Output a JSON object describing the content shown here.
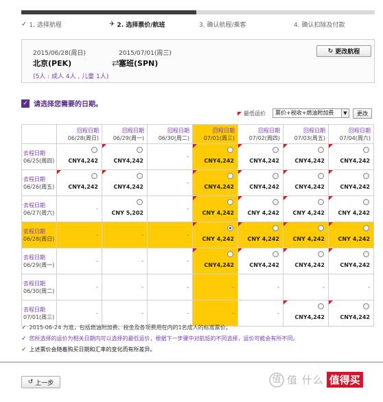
{
  "steps": [
    {
      "label": "1. 选择航程",
      "state": "done"
    },
    {
      "label": "2. 选择票价/航班",
      "state": "active"
    },
    {
      "label": "3. 确认航程/乘客",
      "state": "todo"
    },
    {
      "label": "4. 确认扣除及付款",
      "state": "todo"
    }
  ],
  "trip": {
    "depart_date": "2015/06/28(周日)",
    "return_date": "2015/07/01(周三)",
    "from": "北京(PEK)",
    "to": "塞班(SPN)",
    "arrow": "⇄",
    "pax": "(5人 : 成人 4人 , 儿童 1人)",
    "change_label": "更改航程"
  },
  "prompt": "请选择您需要的日期。",
  "legend_label": "最低运价",
  "fare_select": {
    "value": "票价+税收+燃油附加费"
  },
  "change_small": "更改",
  "grid": {
    "columns": [
      {
        "label": "回程日期",
        "date": "06/28(周日)"
      },
      {
        "label": "回程日期",
        "date": "06/29(周一)"
      },
      {
        "label": "回程日期",
        "date": "06/30(周二)"
      },
      {
        "label": "回程日期",
        "date": "07/01(周三)"
      },
      {
        "label": "回程日期",
        "date": "07/02(周四)"
      },
      {
        "label": "回程日期",
        "date": "07/03(周五)"
      },
      {
        "label": "回程日期",
        "date": "07/04(周六)"
      }
    ],
    "rows": [
      {
        "label": "去程日期",
        "date": "06/25(周四)",
        "cells": [
          {
            "v": "CNY4,242",
            "radio": true,
            "red": false,
            "hl": false
          },
          {
            "v": "CNY4,242",
            "radio": true,
            "red": true,
            "hl": false
          },
          {
            "v": "-",
            "radio": false,
            "red": false,
            "hl": false
          },
          {
            "v": "CNY4,242",
            "radio": true,
            "red": true,
            "hl": true
          },
          {
            "v": "CNY4,242",
            "radio": true,
            "red": true,
            "hl": false
          },
          {
            "v": "CNY4,242",
            "radio": true,
            "red": true,
            "hl": false
          },
          {
            "v": "CNY4,242",
            "radio": true,
            "red": true,
            "hl": false
          }
        ]
      },
      {
        "label": "去程日期",
        "date": "06/26(周五)",
        "cells": [
          {
            "v": "CNY4,242",
            "radio": true,
            "red": true,
            "hl": false
          },
          {
            "v": "CNY4,242",
            "radio": true,
            "red": true,
            "hl": false
          },
          {
            "v": "-",
            "radio": false,
            "red": false,
            "hl": false
          },
          {
            "v": "CNY4,242",
            "radio": true,
            "red": true,
            "hl": true
          },
          {
            "v": "CNY4,242",
            "radio": true,
            "red": true,
            "hl": false
          },
          {
            "v": "CNY4,242",
            "radio": true,
            "red": true,
            "hl": false
          },
          {
            "v": "CNY4,242",
            "radio": true,
            "red": true,
            "hl": false
          }
        ]
      },
      {
        "label": "去程日期",
        "date": "06/27(周六)",
        "cells": [
          {
            "v": "-",
            "radio": false,
            "red": false,
            "hl": false
          },
          {
            "v": "CNY 5,202",
            "radio": true,
            "red": false,
            "hl": false
          },
          {
            "v": "-",
            "radio": false,
            "red": false,
            "hl": false
          },
          {
            "v": "CNY 4,242",
            "radio": true,
            "red": true,
            "hl": true
          },
          {
            "v": "CNY 4,242",
            "radio": true,
            "red": true,
            "hl": false
          },
          {
            "v": "CNY 4,242",
            "radio": true,
            "red": true,
            "hl": false
          },
          {
            "v": "CNY 4,242",
            "radio": true,
            "red": true,
            "hl": false
          }
        ]
      },
      {
        "label": "去程日期",
        "date": "06/28(周日)",
        "row_hl": true,
        "cells": [
          {
            "v": "-",
            "radio": false,
            "red": false,
            "hl": true
          },
          {
            "v": "-",
            "radio": false,
            "red": false,
            "hl": true
          },
          {
            "v": "-",
            "radio": false,
            "red": false,
            "hl": true
          },
          {
            "v": "CNY 4,242",
            "radio": true,
            "on": true,
            "red": true,
            "hl": true
          },
          {
            "v": "CNY 4,242",
            "radio": true,
            "red": true,
            "hl": true
          },
          {
            "v": "CNY 4,242",
            "radio": true,
            "red": true,
            "hl": true
          },
          {
            "v": "CNY 4,242",
            "radio": true,
            "red": true,
            "hl": true
          }
        ]
      },
      {
        "label": "去程日期",
        "date": "06/29(周一)",
        "cells": [
          {
            "v": "-",
            "radio": false,
            "red": false,
            "hl": false
          },
          {
            "v": "-",
            "radio": false,
            "red": false,
            "hl": false
          },
          {
            "v": "-",
            "radio": false,
            "red": false,
            "hl": false
          },
          {
            "v": "CNY4,242",
            "radio": true,
            "red": true,
            "hl": true
          },
          {
            "v": "CNY4,242",
            "radio": true,
            "red": true,
            "hl": false
          },
          {
            "v": "CNY4,242",
            "radio": true,
            "red": true,
            "hl": false
          },
          {
            "v": "CNY4,242",
            "radio": true,
            "red": true,
            "hl": false
          }
        ]
      },
      {
        "label": "去程日期",
        "date": "06/30(周二)",
        "cells": [
          {
            "v": "-",
            "radio": false,
            "red": false,
            "hl": false
          },
          {
            "v": "-",
            "radio": false,
            "red": false,
            "hl": false
          },
          {
            "v": "-",
            "radio": false,
            "red": false,
            "hl": false
          },
          {
            "v": "-",
            "radio": false,
            "red": false,
            "hl": true
          },
          {
            "v": "-",
            "radio": false,
            "red": false,
            "hl": false
          },
          {
            "v": "-",
            "radio": false,
            "red": false,
            "hl": false
          },
          {
            "v": "-",
            "radio": false,
            "red": false,
            "hl": false
          }
        ]
      },
      {
        "label": "去程日期",
        "date": "07/01(周三)",
        "cells": [
          {
            "v": "-",
            "radio": false,
            "red": false,
            "hl": false
          },
          {
            "v": "-",
            "radio": false,
            "red": false,
            "hl": false
          },
          {
            "v": "-",
            "radio": false,
            "red": false,
            "hl": false
          },
          {
            "v": "-",
            "radio": false,
            "red": false,
            "hl": true
          },
          {
            "v": "-",
            "radio": false,
            "red": false,
            "hl": false
          },
          {
            "v": "CNY4,242",
            "radio": true,
            "red": true,
            "hl": false
          },
          {
            "v": "CNY4,242",
            "radio": true,
            "red": true,
            "hl": false
          }
        ]
      }
    ]
  },
  "notes": [
    "2015-06-24 为准，包括燃油附加费、税金及各项费用在内的1名成人的标准票价。",
    "您所选择的运价为相关日期内可以选择的最低运价，根据下一步骤中对航班的不同选择，运价可能会有所不同。",
    "上述票价会随着购买日期和汇率的变化而有所差异。"
  ],
  "back_label": "上一步",
  "watermark": {
    "text": "值 什么",
    "badge": "值得买"
  },
  "colors": {
    "purple": "#5a2e8c",
    "highlight": "#ffcb05",
    "red_flag": "#d02020"
  }
}
